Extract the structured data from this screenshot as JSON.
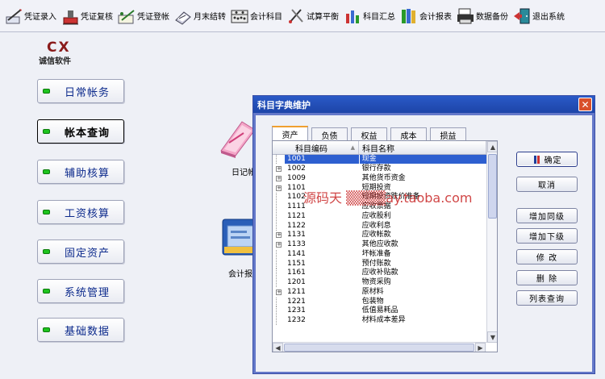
{
  "toolbar": {
    "items": [
      {
        "label": "凭证录入",
        "icon": "pen-voucher-icon"
      },
      {
        "label": "凭证复核",
        "icon": "stamp-check-icon"
      },
      {
        "label": "凭证登帐",
        "icon": "pen-ledger-icon"
      },
      {
        "label": "月末结转",
        "icon": "book-transfer-icon"
      },
      {
        "label": "会计科目",
        "icon": "abacus-icon"
      },
      {
        "label": "试算平衡",
        "icon": "scale-tools-icon"
      },
      {
        "label": "科目汇总",
        "icon": "bar-summary-icon"
      },
      {
        "label": "会计报表",
        "icon": "books-report-icon"
      },
      {
        "label": "数据备份",
        "icon": "printer-backup-icon"
      },
      {
        "label": "退出系统",
        "icon": "exit-door-icon"
      }
    ]
  },
  "logo": {
    "brand": "CX",
    "subtitle": "诚信软件"
  },
  "nav": [
    {
      "label": "日常帐务"
    },
    {
      "label": "帐本查询"
    },
    {
      "label": "辅助核算"
    },
    {
      "label": "工资核算"
    },
    {
      "label": "固定资产"
    },
    {
      "label": "系统管理"
    },
    {
      "label": "基础数据"
    }
  ],
  "desktop": {
    "icon1_label": "日记帐",
    "icon2_label": "会计报"
  },
  "dialog": {
    "title": "科目字典维护",
    "close": "✕",
    "tabs": [
      "资产",
      "负债",
      "权益",
      "成本",
      "损益"
    ],
    "active_tab": "资产",
    "columns": {
      "code": "科目编码",
      "name": "科目名称"
    },
    "rows": [
      {
        "code": "1001",
        "name": "现金",
        "expand": false
      },
      {
        "code": "1002",
        "name": "银行存款",
        "expand": true
      },
      {
        "code": "1009",
        "name": "其他货币资金",
        "expand": true
      },
      {
        "code": "1101",
        "name": "短期投资",
        "expand": true
      },
      {
        "code": "1102",
        "name": "短期投资跌价准备",
        "expand": false
      },
      {
        "code": "1111",
        "name": "应收票据",
        "expand": false
      },
      {
        "code": "1121",
        "name": "应收股利",
        "expand": false
      },
      {
        "code": "1122",
        "name": "应收利息",
        "expand": false
      },
      {
        "code": "1131",
        "name": "应收帐款",
        "expand": true
      },
      {
        "code": "1133",
        "name": "其他应收款",
        "expand": true
      },
      {
        "code": "1141",
        "name": "坏帐准备",
        "expand": false
      },
      {
        "code": "1151",
        "name": "预付账款",
        "expand": false
      },
      {
        "code": "1161",
        "name": "应收补贴款",
        "expand": false
      },
      {
        "code": "1201",
        "name": "物资采购",
        "expand": false
      },
      {
        "code": "1211",
        "name": "原材料",
        "expand": true
      },
      {
        "code": "1221",
        "name": "包装物",
        "expand": false
      },
      {
        "code": "1231",
        "name": "低值易耗品",
        "expand": false
      },
      {
        "code": "1232",
        "name": "材料成本差异",
        "expand": false
      }
    ],
    "selected_row": "1001",
    "buttons": {
      "ok": "确定",
      "cancel": "取消",
      "add_same": "增加同级",
      "add_child": "增加下级",
      "edit": "修 改",
      "delete": "删 除",
      "list_query": "列表查询"
    }
  },
  "watermark": "源码天 ▒▒▒▒ay.taoba.com"
}
